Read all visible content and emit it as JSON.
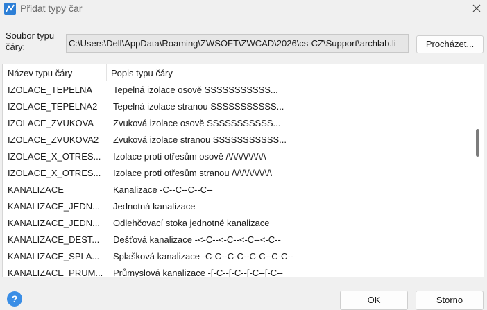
{
  "window": {
    "title": "Přidat typy čar",
    "icon": "zwcad-app-icon",
    "close_icon": "close-icon"
  },
  "file": {
    "label": "Soubor typu čáry:",
    "path": "C:\\Users\\Dell\\AppData\\Roaming\\ZWSOFT\\ZWCAD\\2026\\cs-CZ\\Support\\archlab.li",
    "browse_label": "Procházet..."
  },
  "list": {
    "columns": [
      "Název typu čáry",
      "Popis typu čáry"
    ],
    "rows": [
      [
        "IZOLACE_TEPELNA",
        "Tepelná izolace osově SSSSSSSSSSS..."
      ],
      [
        "IZOLACE_TEPELNA2",
        "Tepelná izolace stranou SSSSSSSSSSS..."
      ],
      [
        "IZOLACE_ZVUKOVA",
        "Zvuková izolace osově SSSSSSSSSSS..."
      ],
      [
        "IZOLACE_ZVUKOVA2",
        "Zvuková izolace stranou SSSSSSSSSSS..."
      ],
      [
        "IZOLACE_X_OTRES...",
        "Izolace proti otřesům osově /\\/\\/\\/\\/\\/\\/\\/\\"
      ],
      [
        "IZOLACE_X_OTRES...",
        "Izolace proti otřesům stranou /\\/\\/\\/\\/\\/\\/\\/\\"
      ],
      [
        "KANALIZACE",
        "Kanalizace -C--C--C--C--"
      ],
      [
        "KANALIZACE_JEDN...",
        "Jednotná kanalizace"
      ],
      [
        "KANALIZACE_JEDN...",
        "Odlehčovací stoka jednotné kanalizace"
      ],
      [
        "KANALIZACE_DEST...",
        "Dešťová kanalizace -<-C--<-C--<-C--<-C--"
      ],
      [
        "KANALIZACE_SPLA...",
        "Splašková kanalizace -C-C--C-C--C-C--C-C--"
      ],
      [
        "KANALIZACE_PRUM...",
        "Průmyslová kanalizace -[-C--[-C--[-C--[-C--"
      ]
    ],
    "scroll_position": 0.35
  },
  "footer": {
    "help_label": "?",
    "ok_label": "OK",
    "cancel_label": "Storno"
  },
  "colors": {
    "accent": "#3a8ee6",
    "background": "#f0f0f0",
    "list_background": "#ffffff"
  }
}
